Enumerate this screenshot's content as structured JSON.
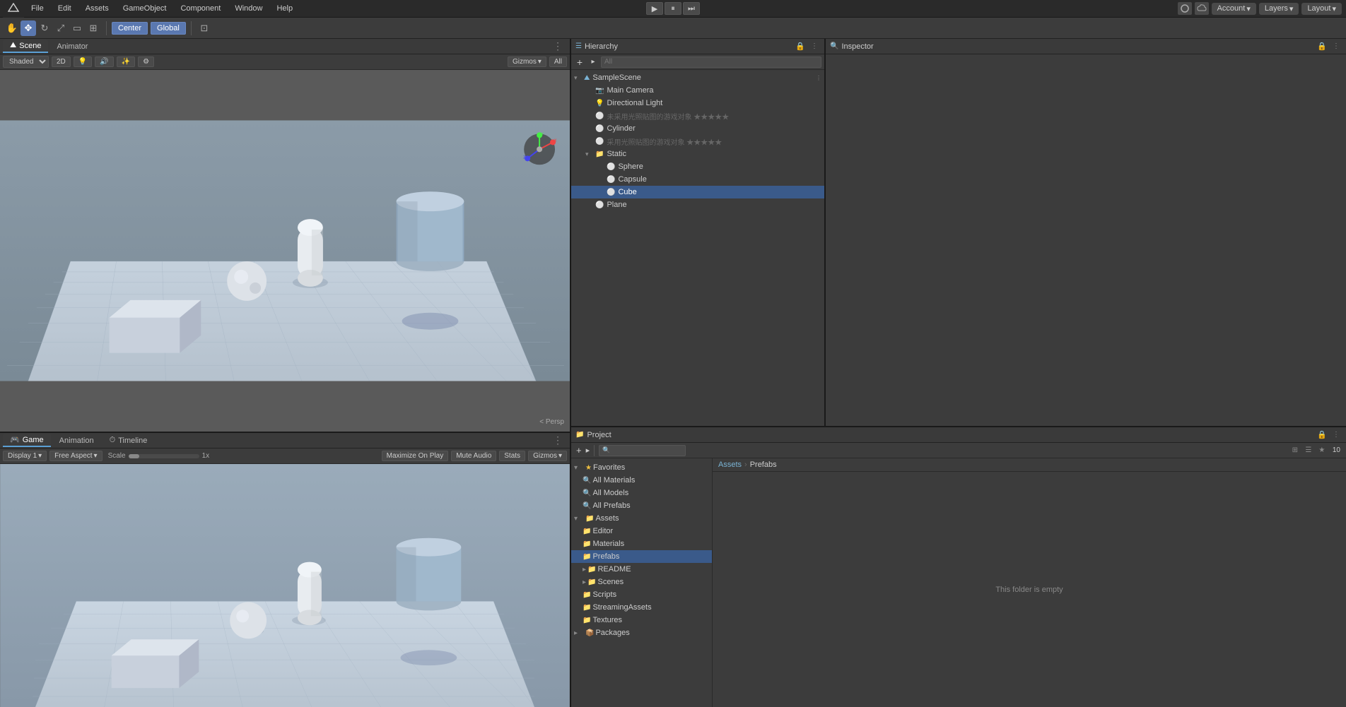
{
  "topMenuBar": {
    "menuItems": [
      "File",
      "Edit",
      "Assets",
      "GameObject",
      "Component",
      "Window",
      "Help"
    ],
    "account": "Account",
    "layers": "Layers",
    "layout": "Layout"
  },
  "toolbar": {
    "tools": [
      "hand",
      "move",
      "rotate",
      "scale",
      "rect",
      "transform"
    ],
    "center": "Center",
    "global": "Global",
    "pivot_icon": "⊞",
    "shaded": "Shaded",
    "twod_label": "2D",
    "gizmos": "Gizmos",
    "all": "All"
  },
  "hierarchy": {
    "title": "Hierarchy",
    "search_placeholder": "All",
    "items": [
      {
        "id": "sampleScene",
        "label": "SampleScene",
        "indent": 0,
        "expanded": true,
        "icon": "scene",
        "type": "scene"
      },
      {
        "id": "mainCamera",
        "label": "Main Camera",
        "indent": 1,
        "icon": "camera",
        "type": "camera"
      },
      {
        "id": "dirLight",
        "label": "Directional Light",
        "indent": 1,
        "icon": "light",
        "type": "light"
      },
      {
        "id": "unnamed1",
        "label": "未采用光照贴图的游戏对象 ★★★★★",
        "indent": 1,
        "icon": "object",
        "type": "object",
        "disabled": true
      },
      {
        "id": "cylinder",
        "label": "Cylinder",
        "indent": 1,
        "icon": "object",
        "type": "object"
      },
      {
        "id": "unnamed2",
        "label": "采用光照贴图的游戏对象 ★★★★★",
        "indent": 1,
        "icon": "object",
        "type": "object",
        "disabled": true
      },
      {
        "id": "static",
        "label": "Static",
        "indent": 1,
        "icon": "folder",
        "type": "folder",
        "expanded": true
      },
      {
        "id": "sphere",
        "label": "Sphere",
        "indent": 2,
        "icon": "object",
        "type": "object"
      },
      {
        "id": "capsule",
        "label": "Capsule",
        "indent": 2,
        "icon": "object",
        "type": "object"
      },
      {
        "id": "cube",
        "label": "Cube",
        "indent": 2,
        "icon": "object",
        "type": "object",
        "selected": true
      },
      {
        "id": "plane",
        "label": "Plane",
        "indent": 1,
        "icon": "object",
        "type": "object"
      }
    ]
  },
  "inspector": {
    "title": "Inspector"
  },
  "project": {
    "title": "Project",
    "search_placeholder": "",
    "favorites": {
      "label": "Favorites",
      "items": [
        {
          "label": "All Materials",
          "icon": "search"
        },
        {
          "label": "All Models",
          "icon": "search"
        },
        {
          "label": "All Prefabs",
          "icon": "search"
        }
      ]
    },
    "assets": {
      "label": "Assets",
      "items": [
        {
          "label": "Editor",
          "icon": "folder"
        },
        {
          "label": "Materials",
          "icon": "folder"
        },
        {
          "label": "Prefabs",
          "icon": "folder",
          "selected": true
        },
        {
          "label": "README",
          "icon": "file"
        },
        {
          "label": "Scenes",
          "icon": "folder"
        },
        {
          "label": "Scripts",
          "icon": "folder"
        },
        {
          "label": "StreamingAssets",
          "icon": "folder"
        },
        {
          "label": "Textures",
          "icon": "folder"
        }
      ]
    },
    "packages": {
      "label": "Packages",
      "icon": "folder"
    },
    "breadcrumb": [
      "Assets",
      "Prefabs"
    ],
    "empty_label": "This folder is empty",
    "zoom_level": "10"
  },
  "sceneTabs": {
    "scene_label": "Scene",
    "animator_label": "Animator"
  },
  "gameTabs": {
    "game_label": "Game",
    "animation_label": "Animation",
    "timeline_label": "Timeline",
    "display": "Display 1",
    "aspect": "Free Aspect",
    "scale_label": "Scale",
    "scale_val": "1x",
    "maximize": "Maximize On Play",
    "mute": "Mute Audio",
    "stats": "Stats",
    "gizmos": "Gizmos"
  },
  "colors": {
    "bg_dark": "#2a2a2a",
    "bg_mid": "#3c3c3c",
    "bg_panel": "#3a3a3a",
    "accent_blue": "#5a9fd4",
    "selected_blue": "#3a5a8a",
    "scene_bg": "#6b7a8a",
    "floor_color": "#c8d0dc",
    "toolbar_bg": "#3c3c3c"
  }
}
